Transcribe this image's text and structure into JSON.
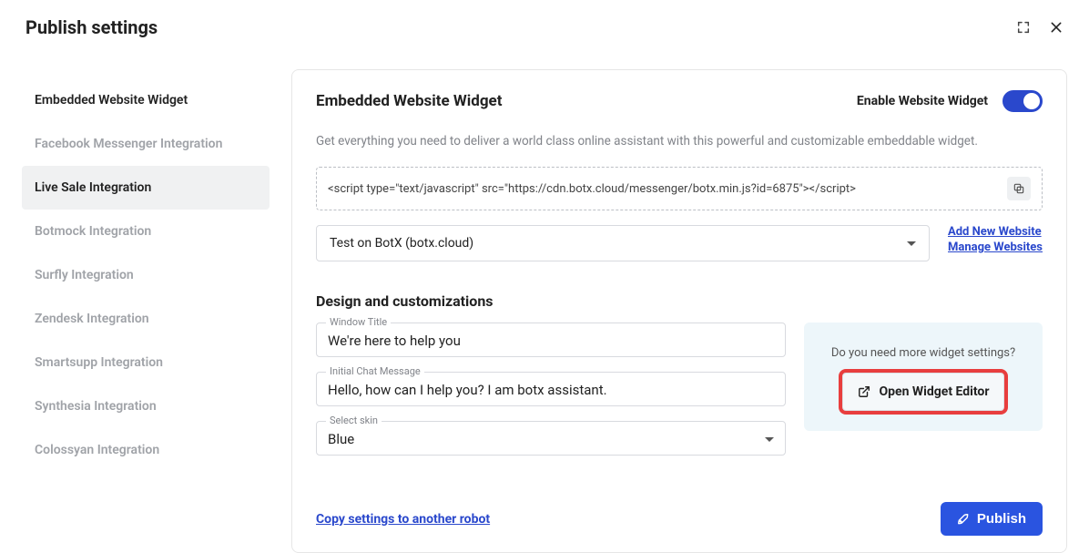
{
  "header": {
    "title": "Publish settings"
  },
  "sidebar": {
    "items": [
      "Embedded Website Widget",
      "Facebook Messenger Integration",
      "Live Sale Integration",
      "Botmock Integration",
      "Surfly Integration",
      "Zendesk Integration",
      "Smartsupp Integration",
      "Synthesia Integration",
      "Colossyan Integration"
    ]
  },
  "main": {
    "title": "Embedded Website Widget",
    "enable_label": "Enable Website Widget",
    "description": "Get everything you need to deliver a world class online assistant with this powerful and customizable embeddable widget.",
    "script_snippet": "<script type=\"text/javascript\" src=\"https://cdn.botx.cloud/messenger/botx.min.js?id=6875\"></script>",
    "site_select": "Test on BotX (botx.cloud)",
    "links": {
      "add": "Add New Website",
      "manage": "Manage Websites"
    },
    "design_title": "Design and customizations",
    "fields": {
      "window_title_label": "Window Title",
      "window_title_value": "We're here to help you",
      "initial_msg_label": "Initial Chat Message",
      "initial_msg_value": "Hello, how can I help you? I am botx assistant.",
      "skin_label": "Select skin",
      "skin_value": "Blue"
    },
    "promo": {
      "question": "Do you need more widget settings?",
      "button": "Open Widget Editor"
    },
    "footer": {
      "copy_link": "Copy settings to another robot",
      "publish": "Publish"
    }
  }
}
